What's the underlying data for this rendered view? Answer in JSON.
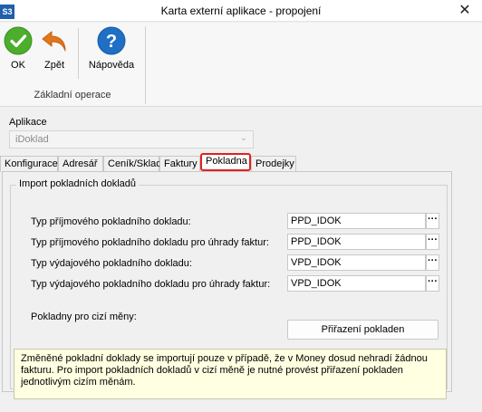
{
  "window": {
    "badge": "S3",
    "title": "Karta externí aplikace - propojení",
    "close_icon": "close-icon"
  },
  "ribbon": {
    "ok_label": "OK",
    "back_label": "Zpět",
    "help_label": "Nápověda",
    "group_label": "Základní operace",
    "colors": {
      "ok": "#4cae2c",
      "back": "#e2761b",
      "help": "#1f6fc5"
    }
  },
  "application": {
    "label": "Aplikace",
    "value": "iDoklad"
  },
  "tabs": [
    {
      "label": "Konfigurace"
    },
    {
      "label": "Adresář"
    },
    {
      "label": "Ceník/Sklad"
    },
    {
      "label": "Faktury"
    },
    {
      "label": "Pokladna",
      "active": true
    },
    {
      "label": "Prodejky"
    }
  ],
  "panel": {
    "group_title": "Import pokladních dokladů",
    "rows": [
      {
        "label": "Typ příjmového pokladního dokladu:",
        "value": "PPD_IDOK"
      },
      {
        "label": "Typ příjmového pokladního dokladu pro úhrady faktur:",
        "value": "PPD_IDOK"
      },
      {
        "label": "Typ výdajového pokladního dokladu:",
        "value": "VPD_IDOK"
      },
      {
        "label": "Typ výdajového pokladního dokladu pro úhrady faktur:",
        "value": "VPD_IDOK"
      }
    ],
    "dots_label": "···",
    "foreign_label": "Pokladny pro cizí měny:",
    "assign_button": "Přiřazení pokladen",
    "note": "Změněné pokladní doklady se importují pouze v případě, že v Money dosud nehradí žádnou fakturu. Pro import pokladních dokladů v cizí měně je nutné provést přiřazení pokladen jednotlivým cizím měnám."
  }
}
